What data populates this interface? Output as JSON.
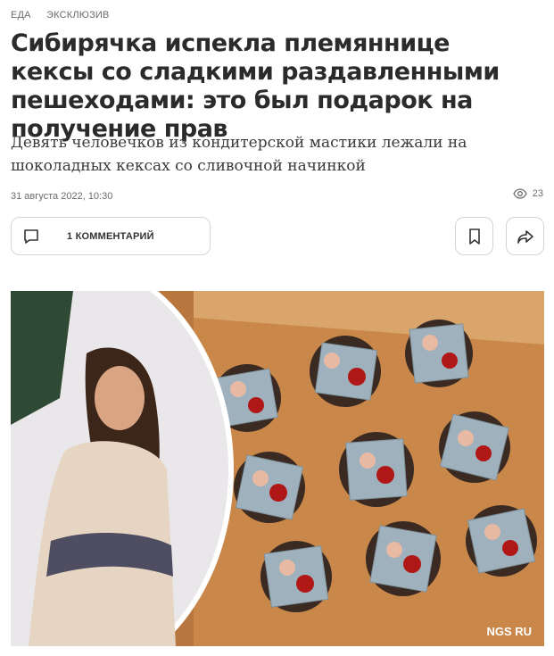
{
  "tags": [
    "ЕДА",
    "ЭКСКЛЮЗИВ"
  ],
  "article": {
    "title": "Сибирячка испекла племяннице кексы со сладкими раздавленными пешеходами: это был подарок на получение прав",
    "subtitle": "Девять человечков из кондитерской мастики лежали на шоколадных кексах со сливочной начинкой",
    "date": "31 августа 2022, 10:30",
    "views": "23"
  },
  "actions": {
    "comments_label": "1 КОММЕНТАРИЙ",
    "bookmark_icon": "bookmark-icon",
    "share_icon": "share-icon"
  },
  "photo": {
    "watermark": "NGS RU"
  }
}
